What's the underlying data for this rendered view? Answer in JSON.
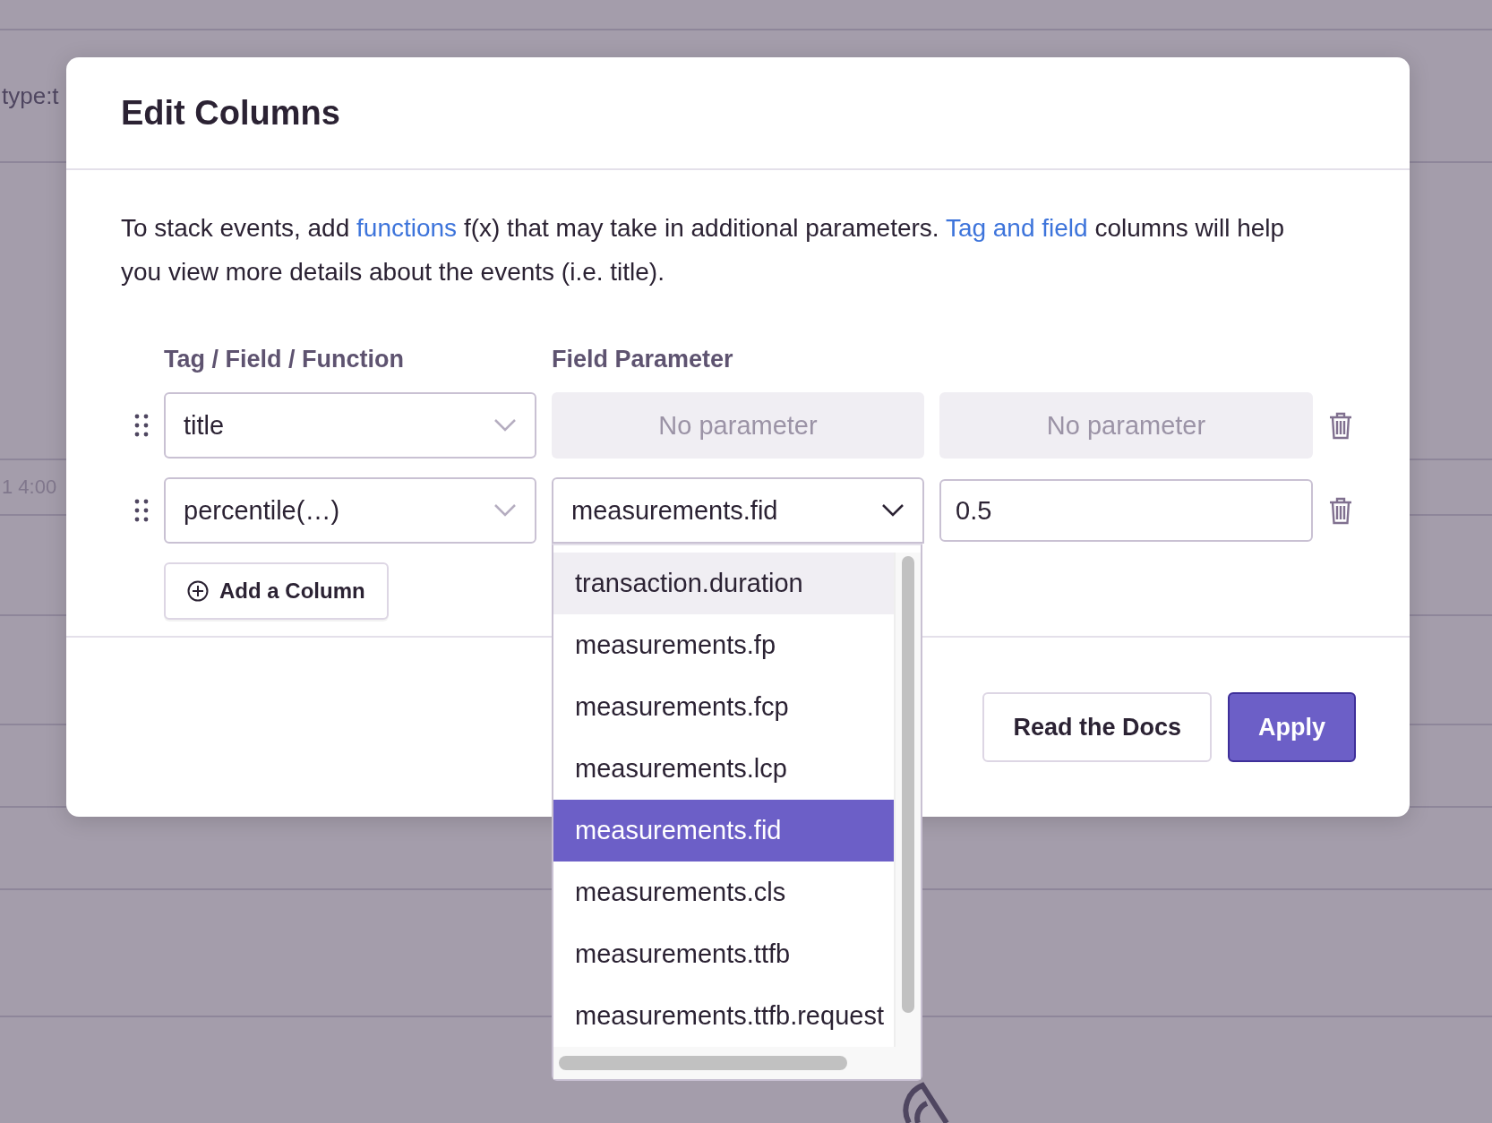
{
  "background": {
    "filter_text": "type:t",
    "axis_label": "1 4:00"
  },
  "dialog": {
    "title": "Edit Columns",
    "description": [
      {
        "text": "To stack events, add ",
        "link": false
      },
      {
        "text": "functions",
        "link": true
      },
      {
        "text": " f(x) that may take in additional parameters. ",
        "link": false
      },
      {
        "text": "Tag and field",
        "link": true
      },
      {
        "text": " columns will help you view more details about the events (i.e. title).",
        "link": false
      }
    ],
    "column_headers": [
      "Tag / Field / Function",
      "Field Parameter"
    ],
    "rows": [
      {
        "field": "title",
        "params": [
          {
            "kind": "disabled",
            "text": "No parameter"
          },
          {
            "kind": "disabled",
            "text": "No parameter"
          }
        ]
      },
      {
        "field": "percentile(…)",
        "params": [
          {
            "kind": "select",
            "value": "measurements.fid",
            "expanded": true,
            "options": [
              {
                "label": "transaction.duration",
                "selected": false,
                "highlighted": true
              },
              {
                "label": "measurements.fp",
                "selected": false,
                "highlighted": false
              },
              {
                "label": "measurements.fcp",
                "selected": false,
                "highlighted": false
              },
              {
                "label": "measurements.lcp",
                "selected": false,
                "highlighted": false
              },
              {
                "label": "measurements.fid",
                "selected": true,
                "highlighted": false
              },
              {
                "label": "measurements.cls",
                "selected": false,
                "highlighted": false
              },
              {
                "label": "measurements.ttfb",
                "selected": false,
                "highlighted": false
              },
              {
                "label": "measurements.ttfb.request",
                "selected": false,
                "highlighted": false
              }
            ]
          },
          {
            "kind": "input",
            "value": "0.5"
          }
        ]
      }
    ],
    "add_button": "Add a Column",
    "buttons": [
      {
        "label": "Read the Docs",
        "kind": "secondary"
      },
      {
        "label": "Apply",
        "kind": "primary"
      }
    ]
  }
}
